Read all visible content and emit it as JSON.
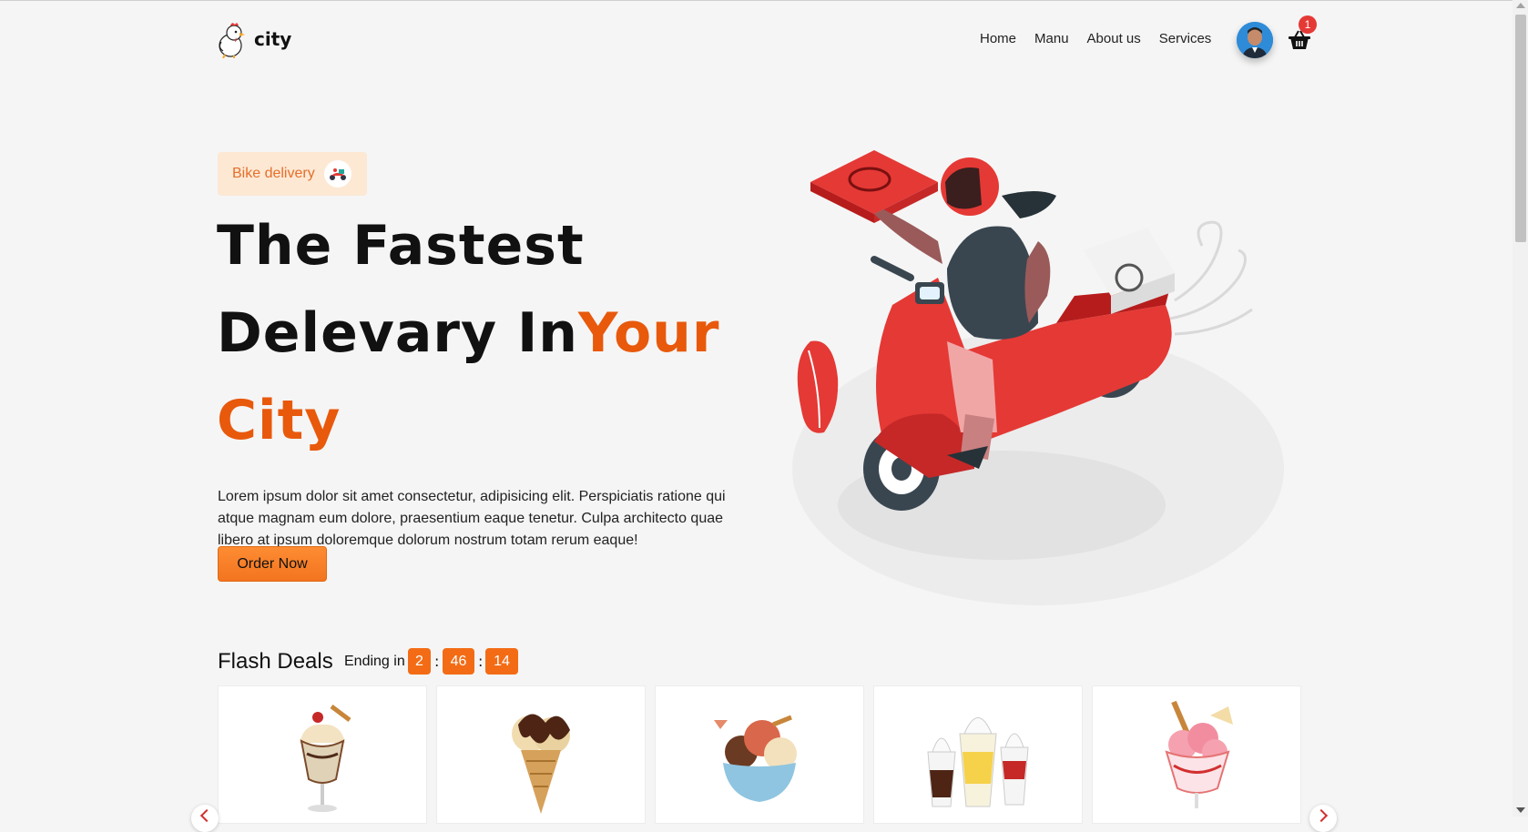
{
  "brand": {
    "name": "city"
  },
  "nav": {
    "items": [
      "Home",
      "Manu",
      "About us",
      "Services"
    ]
  },
  "cart": {
    "count": "1"
  },
  "hero": {
    "badge": "Bike delivery",
    "line1": "The Fastest",
    "line2": "Delevary In",
    "line2_accent": "Your",
    "line3": "City",
    "description": "Lorem ipsum dolor sit amet consectetur, adipisicing elit. Perspiciatis ratione qui atque magnam eum dolore, praesentium eaque tenetur. Culpa architecto quae libero at ipsum doloremque dolorum nostrum totam rerum eaque!",
    "cta": "Order Now"
  },
  "flash": {
    "title": "Flash Deals",
    "ending_label": "Ending in",
    "hours": "2",
    "minutes": "46",
    "seconds": "14",
    "separator": ":"
  },
  "colors": {
    "accent": "#e8590c",
    "button": "#f7802a",
    "badge_bg": "#fde8d4"
  },
  "products": [
    {
      "icon": "sundae-icon"
    },
    {
      "icon": "chocolate-cone-icon"
    },
    {
      "icon": "ice-cream-bowl-icon"
    },
    {
      "icon": "soft-serve-cups-icon"
    },
    {
      "icon": "strawberry-sundae-icon"
    }
  ]
}
